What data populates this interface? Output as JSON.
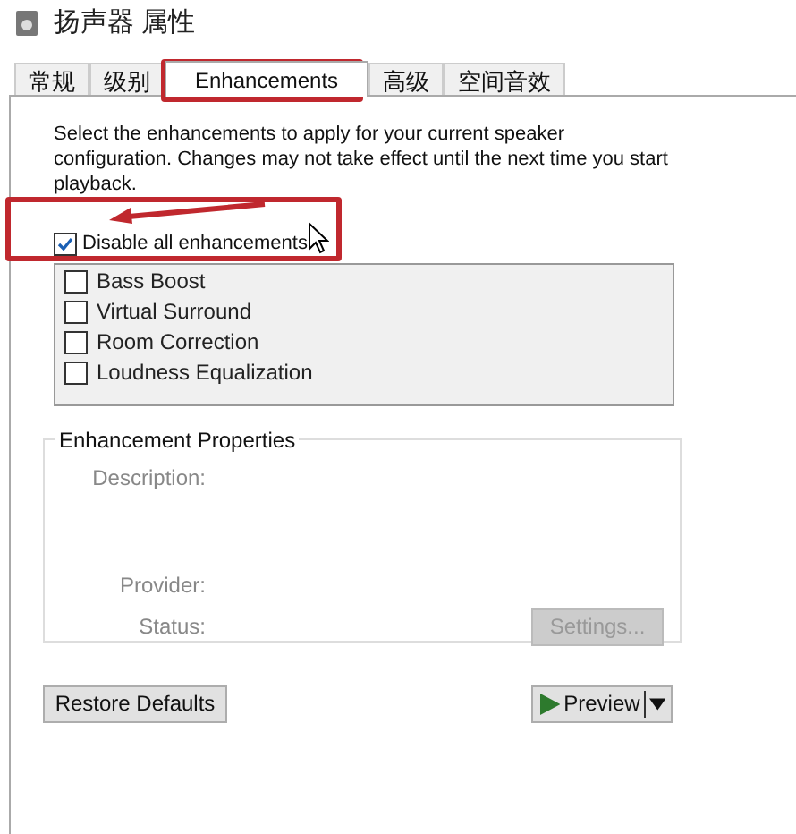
{
  "window": {
    "title": "扬声器 属性"
  },
  "tabs": [
    {
      "label": "常规",
      "selected": false
    },
    {
      "label": "级别",
      "selected": false
    },
    {
      "label": "Enhancements",
      "selected": true
    },
    {
      "label": "高级",
      "selected": false
    },
    {
      "label": "空间音效",
      "selected": false
    }
  ],
  "intro": "Select the enhancements to apply for your current speaker configuration. Changes may not take effect until the next time you start playback.",
  "disable_all": {
    "label": "Disable all enhancements",
    "checked": true
  },
  "enhancements": [
    {
      "label": "Bass Boost",
      "checked": false
    },
    {
      "label": "Virtual Surround",
      "checked": false
    },
    {
      "label": "Room Correction",
      "checked": false
    },
    {
      "label": "Loudness Equalization",
      "checked": false
    }
  ],
  "properties": {
    "title": "Enhancement Properties",
    "description_label": "Description:",
    "provider_label": "Provider:",
    "status_label": "Status:",
    "settings_button": {
      "label": "Settings...",
      "disabled": true
    }
  },
  "buttons": {
    "restore": "Restore Defaults",
    "preview": "Preview"
  }
}
